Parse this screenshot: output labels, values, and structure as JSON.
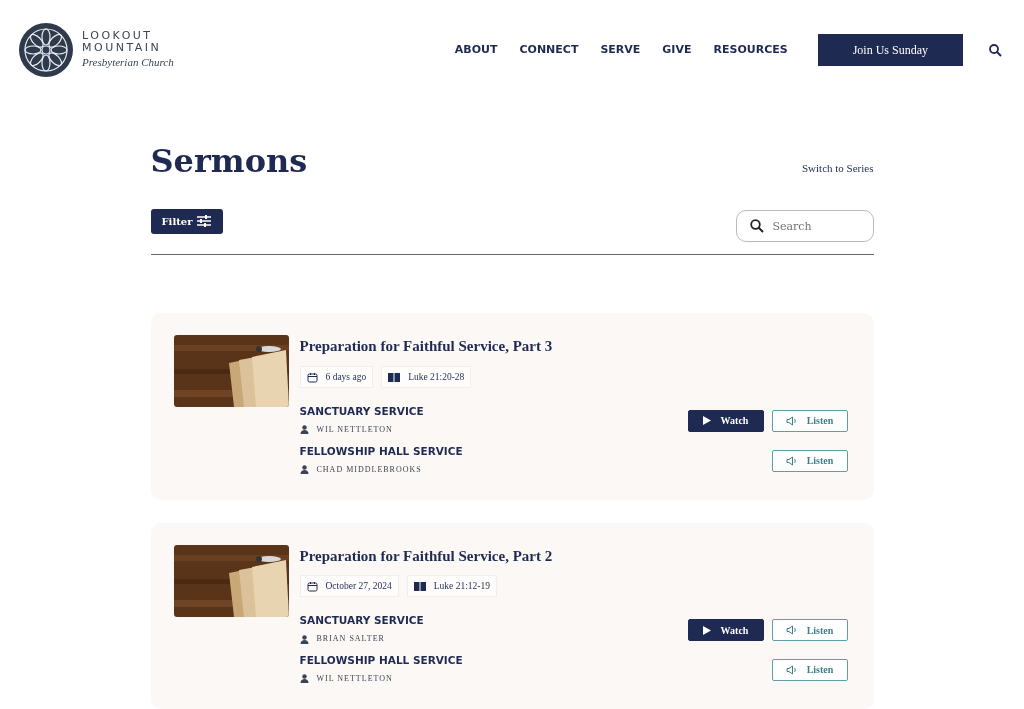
{
  "header": {
    "logo": {
      "line_1": "LOOKOUT",
      "line_2": "MOUNTAIN",
      "line_3": "Presbyterian Church"
    },
    "nav": [
      {
        "label": "ABOUT"
      },
      {
        "label": "CONNECT"
      },
      {
        "label": "SERVE"
      },
      {
        "label": "GIVE"
      },
      {
        "label": "RESOURCES"
      }
    ],
    "cta": "Join Us Sunday"
  },
  "page": {
    "title": "Sermons",
    "switch_link": "Switch to Series",
    "filter_button": "Filter",
    "search": {
      "placeholder": "Search"
    }
  },
  "sermons": [
    {
      "title": "Preparation for Faithful Service, Part 3",
      "date": "6 days ago",
      "passage": "Luke 21:20-28",
      "services": [
        {
          "name": "SANCTUARY SERVICE",
          "speaker": "WIL NETTLETON",
          "buttons": [
            {
              "kind": "watch",
              "label": "Watch"
            },
            {
              "kind": "listen",
              "label": "Listen"
            }
          ]
        },
        {
          "name": "FELLOWSHIP HALL SERVICE",
          "speaker": "CHAD MIDDLEBROOKS",
          "buttons": [
            {
              "kind": "listen",
              "label": "Listen"
            }
          ]
        }
      ]
    },
    {
      "title": "Preparation for Faithful Service, Part 2",
      "date": "October 27, 2024",
      "passage": "Luke 21:12-19",
      "services": [
        {
          "name": "SANCTUARY SERVICE",
          "speaker": "BRIAN SALTER",
          "buttons": [
            {
              "kind": "watch",
              "label": "Watch"
            },
            {
              "kind": "listen",
              "label": "Listen"
            }
          ]
        },
        {
          "name": "FELLOWSHIP HALL SERVICE",
          "speaker": "WIL NETTLETON",
          "buttons": [
            {
              "kind": "listen",
              "label": "Listen"
            }
          ]
        }
      ]
    }
  ]
}
